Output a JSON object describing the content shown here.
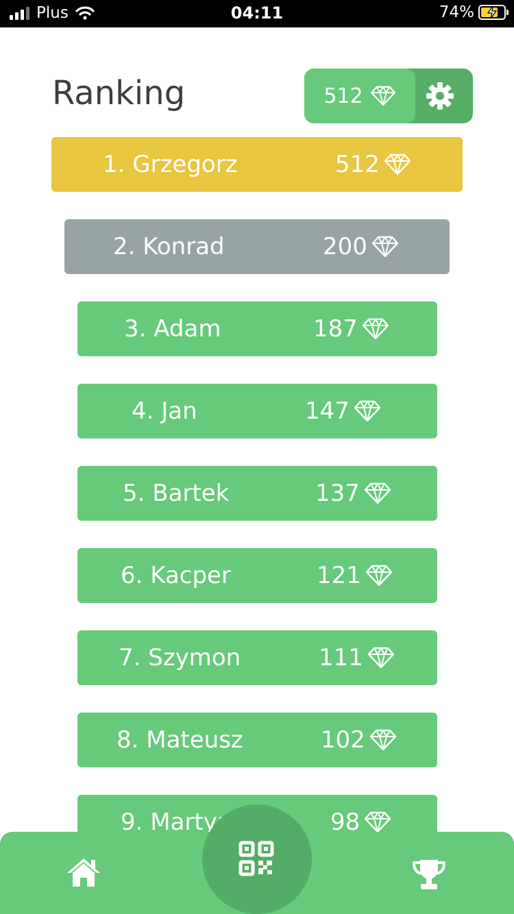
{
  "status_bar": {
    "carrier": "Plus",
    "time": "04:11",
    "battery": "74%"
  },
  "header": {
    "title": "Ranking",
    "balance": "512",
    "settings_icon": "gear-icon",
    "currency_icon": "diamond-icon"
  },
  "ranking": [
    {
      "name": "1. Grzegorz",
      "score": "512"
    },
    {
      "name": "2. Konrad",
      "score": "200"
    },
    {
      "name": "3. Adam",
      "score": "187"
    },
    {
      "name": "4. Jan",
      "score": "147"
    },
    {
      "name": "5. Bartek",
      "score": "137"
    },
    {
      "name": "6. Kacper",
      "score": "121"
    },
    {
      "name": "7. Szymon",
      "score": "111"
    },
    {
      "name": "8. Mateusz",
      "score": "102"
    },
    {
      "name": "9. Martyna",
      "score": "98"
    }
  ],
  "bottom_nav": {
    "items": [
      "home-icon",
      "qr-code-icon",
      "trophy-icon"
    ]
  },
  "colors": {
    "gold": "#e8c640",
    "silver": "#98a3a5",
    "green": "#66ca7a",
    "dark_green": "#54ad66"
  }
}
